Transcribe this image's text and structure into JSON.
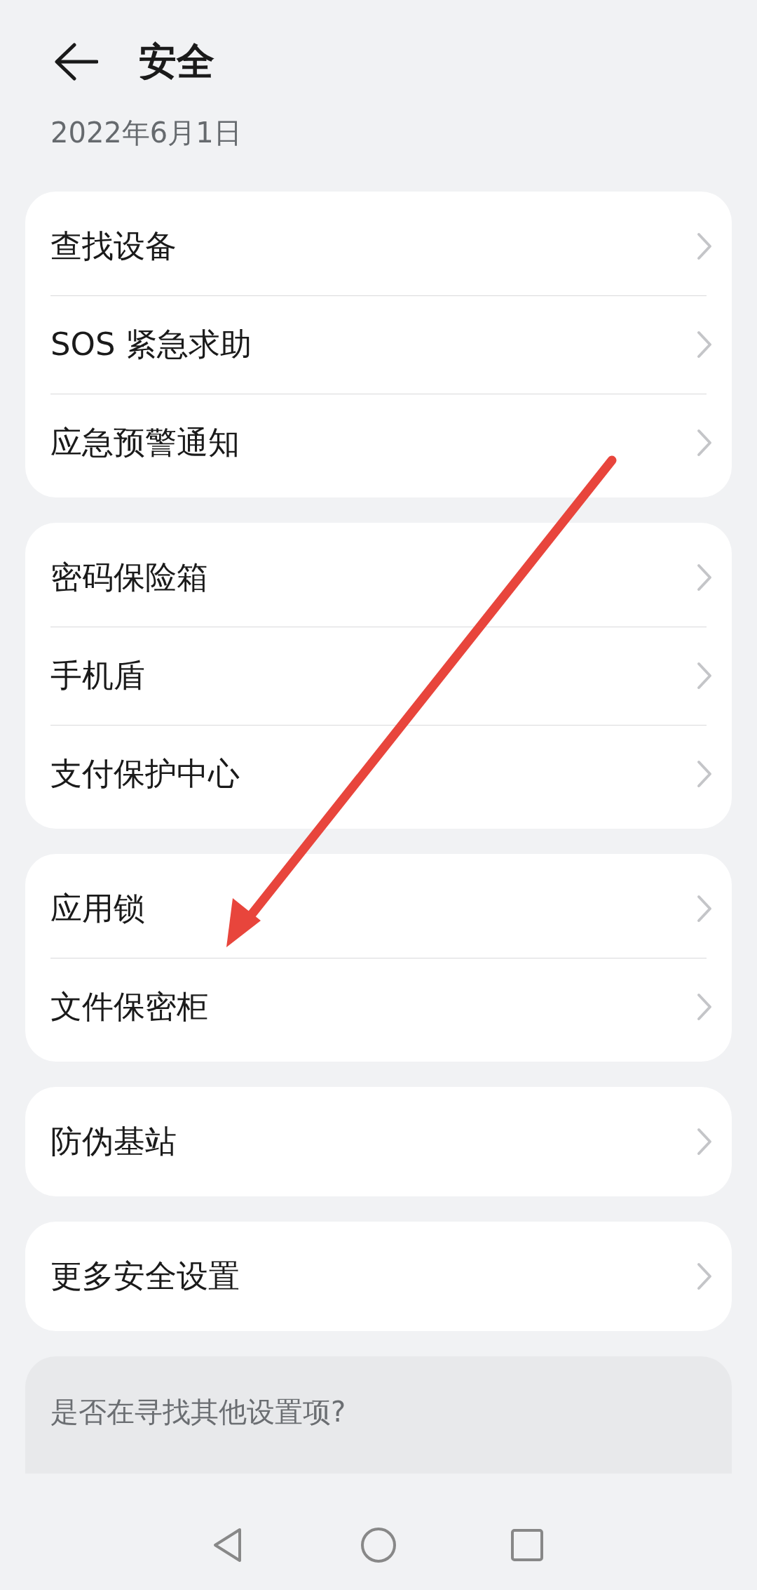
{
  "header": {
    "title": "安全",
    "date": "2022年6月1日"
  },
  "groups": [
    {
      "items": [
        {
          "label": "查找设备"
        },
        {
          "label": "SOS 紧急求助"
        },
        {
          "label": "应急预警通知"
        }
      ]
    },
    {
      "items": [
        {
          "label": "密码保险箱"
        },
        {
          "label": "手机盾"
        },
        {
          "label": "支付保护中心"
        }
      ]
    },
    {
      "items": [
        {
          "label": "应用锁"
        },
        {
          "label": "文件保密柜"
        }
      ]
    },
    {
      "items": [
        {
          "label": "防伪基站"
        }
      ]
    },
    {
      "items": [
        {
          "label": "更多安全设置"
        }
      ]
    }
  ],
  "hint": {
    "text": "是否在寻找其他设置项?"
  }
}
